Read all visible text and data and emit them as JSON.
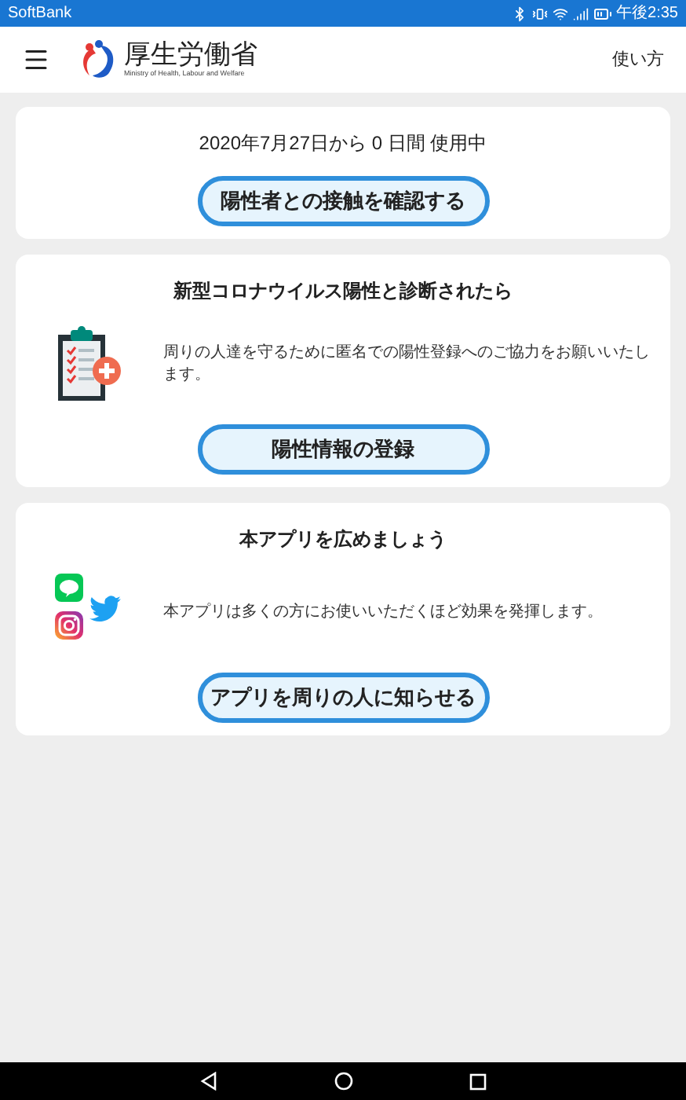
{
  "status_bar": {
    "carrier": "SoftBank",
    "time": "午後2:35"
  },
  "header": {
    "logo_title": "厚生労働省",
    "logo_subtitle": "Ministry of Health, Labour and Welfare",
    "help_link": "使い方"
  },
  "cards": [
    {
      "kind": "usage",
      "text": "2020年7月27日から 0 日間 使用中",
      "button": "陽性者との接触を確認する"
    },
    {
      "kind": "report",
      "title": "新型コロナウイルス陽性と診断されたら",
      "text": "周りの人達を守るために匿名での陽性登録へのご協力をお願いいたします。",
      "button": "陽性情報の登録"
    },
    {
      "kind": "share",
      "title": "本アプリを広めましょう",
      "text": "本アプリは多くの方にお使いいただくほど効果を発揮します。",
      "button": "アプリを周りの人に知らせる"
    }
  ]
}
